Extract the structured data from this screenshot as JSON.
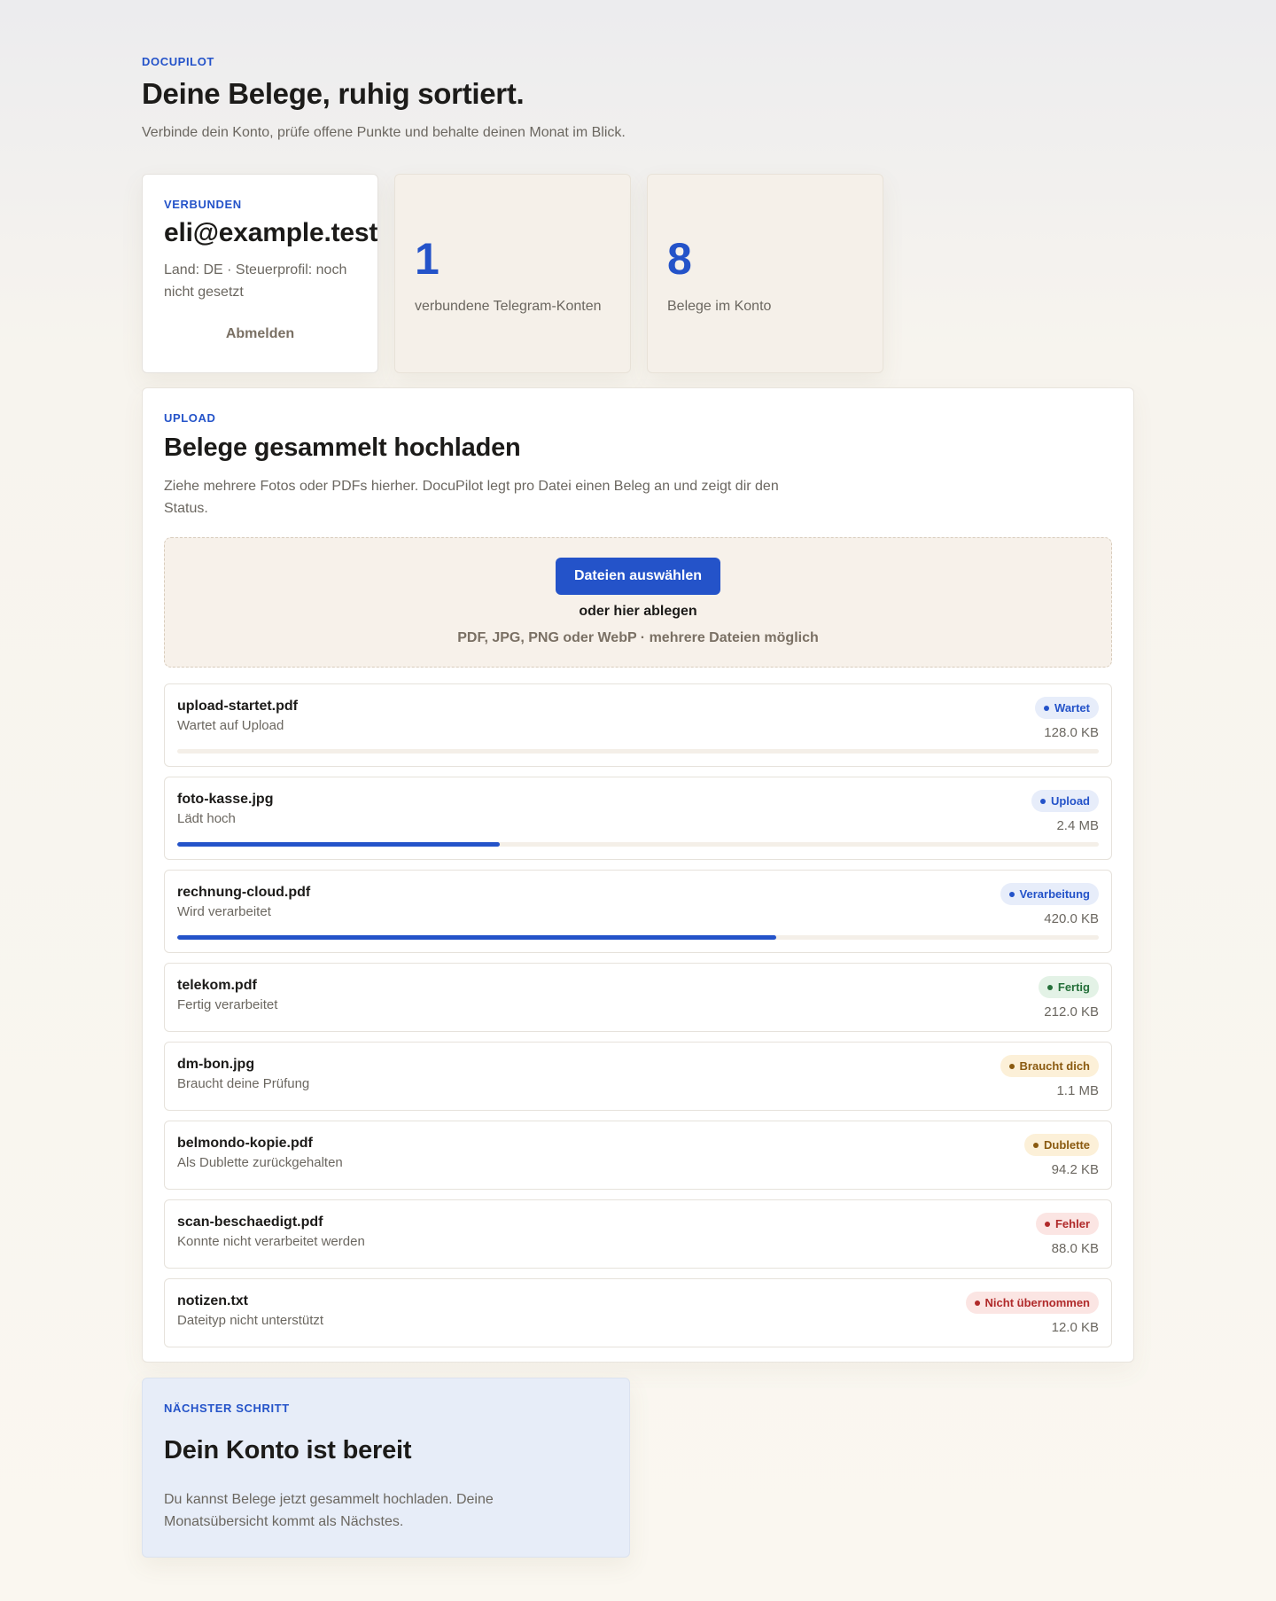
{
  "header": {
    "brand": "DOCUPILOT",
    "title": "Deine Belege, ruhig sortiert.",
    "subtitle": "Verbinde dein Konto, prüfe offene Punkte und behalte deinen Monat im Blick."
  },
  "account": {
    "eyebrow": "VERBUNDEN",
    "email": "eli@example.test",
    "meta": "Land: DE · Steuerprofil: noch nicht gesetzt",
    "logout_label": "Abmelden"
  },
  "stats": [
    {
      "value": "1",
      "label": "verbundene Telegram-Konten"
    },
    {
      "value": "8",
      "label": "Belege im Konto"
    }
  ],
  "upload": {
    "eyebrow": "UPLOAD",
    "title": "Belege gesammelt hochladen",
    "description": "Ziehe mehrere Fotos oder PDFs hierher. DocuPilot legt pro Datei einen Beleg an und zeigt dir den Status.",
    "select_button": "Dateien auswählen",
    "drop_hint": "oder hier ablegen",
    "file_types": "PDF, JPG, PNG oder WebP · mehrere Dateien möglich",
    "files": [
      {
        "name": "upload-startet.pdf",
        "status": "Wartet auf Upload",
        "badge": "Wartet",
        "tone": "blue",
        "size": "128.0 KB",
        "progress": 0
      },
      {
        "name": "foto-kasse.jpg",
        "status": "Lädt hoch",
        "badge": "Upload",
        "tone": "blue",
        "size": "2.4 MB",
        "progress": 0.35
      },
      {
        "name": "rechnung-cloud.pdf",
        "status": "Wird verarbeitet",
        "badge": "Verarbeitung",
        "tone": "blue",
        "size": "420.0 KB",
        "progress": 0.65
      },
      {
        "name": "telekom.pdf",
        "status": "Fertig verarbeitet",
        "badge": "Fertig",
        "tone": "green",
        "size": "212.0 KB"
      },
      {
        "name": "dm-bon.jpg",
        "status": "Braucht deine Prüfung",
        "badge": "Braucht dich",
        "tone": "amber",
        "size": "1.1 MB"
      },
      {
        "name": "belmondo-kopie.pdf",
        "status": "Als Dublette zurückgehalten",
        "badge": "Dublette",
        "tone": "amber",
        "size": "94.2 KB"
      },
      {
        "name": "scan-beschaedigt.pdf",
        "status": "Konnte nicht verarbeitet werden",
        "badge": "Fehler",
        "tone": "red",
        "size": "88.0 KB"
      },
      {
        "name": "notizen.txt",
        "status": "Dateityp nicht unterstützt",
        "badge": "Nicht übernommen",
        "tone": "red",
        "size": "12.0 KB"
      }
    ]
  },
  "next_step": {
    "eyebrow": "NÄCHSTER SCHRITT",
    "title": "Dein Konto ist bereit",
    "text": "Du kannst Belege jetzt gesammelt hochladen. Deine Monatsübersicht kommt als Nächstes."
  },
  "colors": {
    "accent": "#2453c9",
    "green": "#25703a",
    "amber": "#8a5a10",
    "red": "#b02a2a"
  }
}
